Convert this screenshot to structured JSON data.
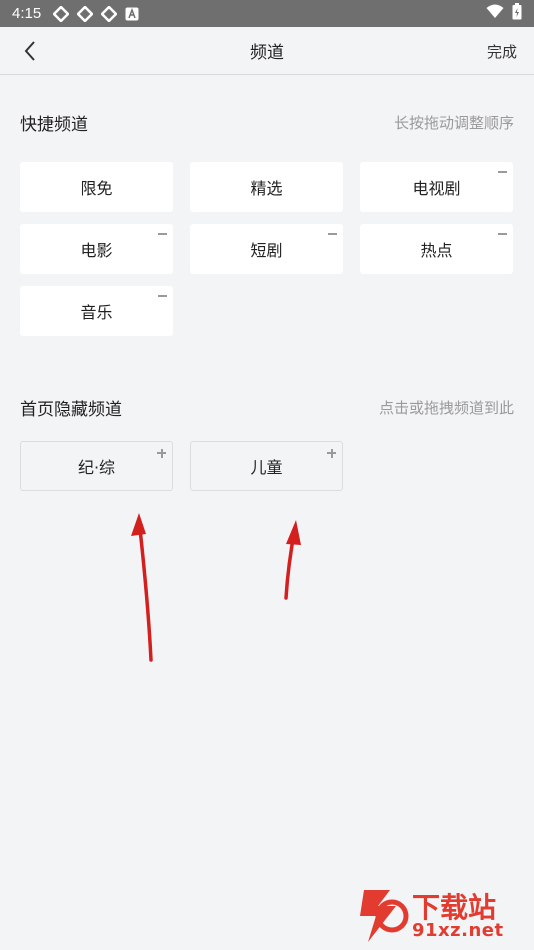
{
  "status": {
    "time": "4:15"
  },
  "header": {
    "title": "频道",
    "done_label": "完成"
  },
  "quick_channels": {
    "title": "快捷频道",
    "hint": "长按拖动调整顺序",
    "items": [
      {
        "label": "限免",
        "removable": false
      },
      {
        "label": "精选",
        "removable": false
      },
      {
        "label": "电视剧",
        "removable": true
      },
      {
        "label": "电影",
        "removable": true
      },
      {
        "label": "短剧",
        "removable": true
      },
      {
        "label": "热点",
        "removable": true
      },
      {
        "label": "音乐",
        "removable": true
      }
    ]
  },
  "hidden_channels": {
    "title": "首页隐藏频道",
    "hint": "点击或拖拽频道到此",
    "items": [
      {
        "label": "纪·综"
      },
      {
        "label": "儿童"
      }
    ]
  },
  "watermark": {
    "line1": "下载站",
    "line2": "91xz.net"
  },
  "colors": {
    "background": "#f3f4f6",
    "chip": "#ffffff",
    "hint": "#9a9a9a",
    "arrow": "#d41f1f",
    "watermark": "#e23b30"
  }
}
